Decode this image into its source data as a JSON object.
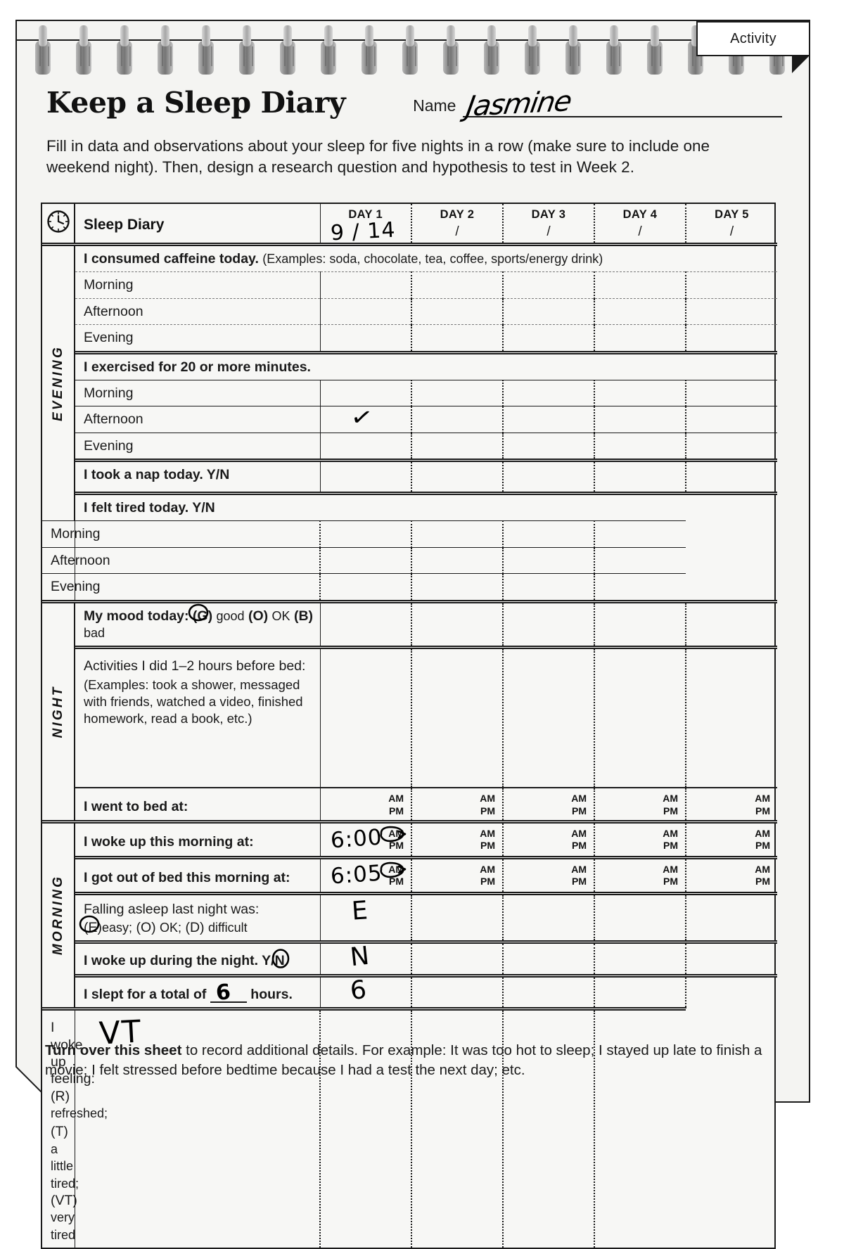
{
  "tab": {
    "label": "Activity"
  },
  "header": {
    "title": "Keep a Sleep Diary",
    "name_label": "Name",
    "name_value": "Jasmine",
    "intro": "Fill in data and observations about your sleep for five nights in a row (make sure to include one weekend night). Then, design a research question and hypothesis to test in Week 2."
  },
  "table": {
    "clock_icon": "clock-icon",
    "corner_title": "Sleep Diary",
    "days": [
      {
        "name": "DAY 1",
        "date": "9 / 14"
      },
      {
        "name": "DAY 2",
        "date": "/"
      },
      {
        "name": "DAY 3",
        "date": "/"
      },
      {
        "name": "DAY 4",
        "date": "/"
      },
      {
        "name": "DAY 5",
        "date": "/"
      }
    ],
    "bands": {
      "evening": "EVENING",
      "night": "NIGHT",
      "morning": "MORNING"
    },
    "ampm": {
      "am": "AM",
      "pm": "PM"
    },
    "rows": {
      "caffeine_title": "I consumed caffeine today.",
      "caffeine_note": "(Examples: soda, chocolate, tea, coffee, sports/energy drink)",
      "morning": "Morning",
      "afternoon": "Afternoon",
      "evening": "Evening",
      "exercise_title": "I exercised for 20 or more minutes.",
      "nap": "I took a nap today. Y/N",
      "tired": "I felt tired today. Y/N",
      "mood_prefix": "My mood today:",
      "mood_g": "(G)",
      "mood_good": "good",
      "mood_o": "(O)",
      "mood_ok": "OK",
      "mood_b": "(B)",
      "mood_bad": "bad",
      "activities_title": "Activities I did 1–2 hours before bed:",
      "activities_note": "(Examples: took a shower, messaged with friends, watched a video, finished homework, read a book, etc.)",
      "went_bed": "I went to bed at:",
      "woke_up": "I woke up this morning at:",
      "got_out": "I got out of bed this morning at:",
      "falling_title": "Falling asleep last night was:",
      "falling_e": "(E)",
      "falling_easy": "easy;",
      "falling_o": "(O)",
      "falling_ok": "OK;",
      "falling_d": "(D)",
      "falling_difficult": "difficult",
      "woke_night_pre": "I woke up during the night.  Y/",
      "woke_night_n": "N",
      "slept_pre": "I slept for a total of",
      "slept_post": "hours.",
      "slept_blank": "6",
      "feeling_line1_pre": "I woke up feeling:",
      "feeling_r": "(R)",
      "feeling_refreshed": "refreshed;",
      "feeling_t": "(T)",
      "feeling_little": "a little tired;",
      "feeling_vt": "(VT)",
      "feeling_very": "very tired"
    },
    "answers": {
      "exercise_afternoon_day1": "✓",
      "woke_up_day1": "6:00",
      "got_out_day1": "6:05",
      "falling_day1": "E",
      "woke_night_day1": "N",
      "slept_day1": "6",
      "feeling_day1": "VT"
    }
  },
  "footer": {
    "bold": "Turn over this sheet",
    "rest": " to record additional details. For example: It was too hot to sleep; I stayed up late to finish a movie; I felt stressed before bedtime because I had a test the next day; etc."
  }
}
